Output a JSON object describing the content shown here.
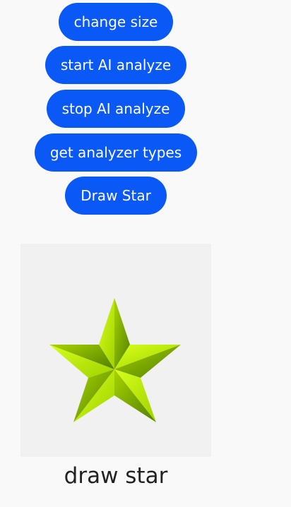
{
  "buttons": {
    "change_size": "change size",
    "start_ai": "start AI analyze",
    "stop_ai": "stop AI analyze",
    "get_types": "get analyzer types",
    "draw_star": "Draw Star"
  },
  "canvas": {
    "caption": "draw star",
    "star_light_color": "#c8ff00",
    "star_dark_color": "#5f8f00"
  },
  "colors": {
    "button_bg": "#0a59f7",
    "button_text": "#ffffff",
    "page_bg": "#f9f9f9",
    "canvas_bg": "#f1f1f1"
  }
}
